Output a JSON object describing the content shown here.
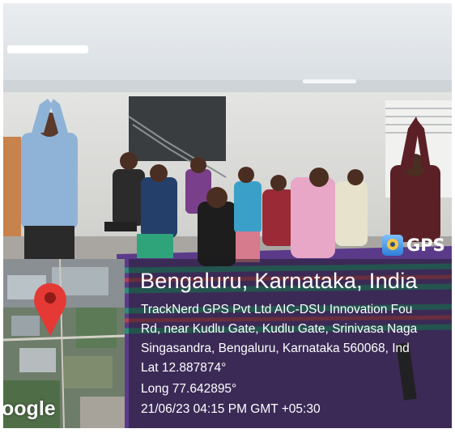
{
  "gps_badge": {
    "icon": "gps-map-camera-icon",
    "label": "GPS"
  },
  "map": {
    "logo_text": "oogle",
    "pin_icon": "location-pin-icon",
    "pin_color": "#e53935"
  },
  "location": {
    "place": "Bengaluru, Karnataka, India",
    "address_lines": [
      "TrackNerd GPS Pvt Ltd AIC-DSU Innovation Fou",
      "Rd, near Kudlu Gate, Kudlu Gate, Srinivasa Naga",
      "Singasandra, Bengaluru, Karnataka 560068, Ind"
    ],
    "latitude": "Lat 12.887874°",
    "longitude": "Long 77.642895°",
    "timestamp": "21/06/23 04:15 PM GMT +05:30"
  }
}
